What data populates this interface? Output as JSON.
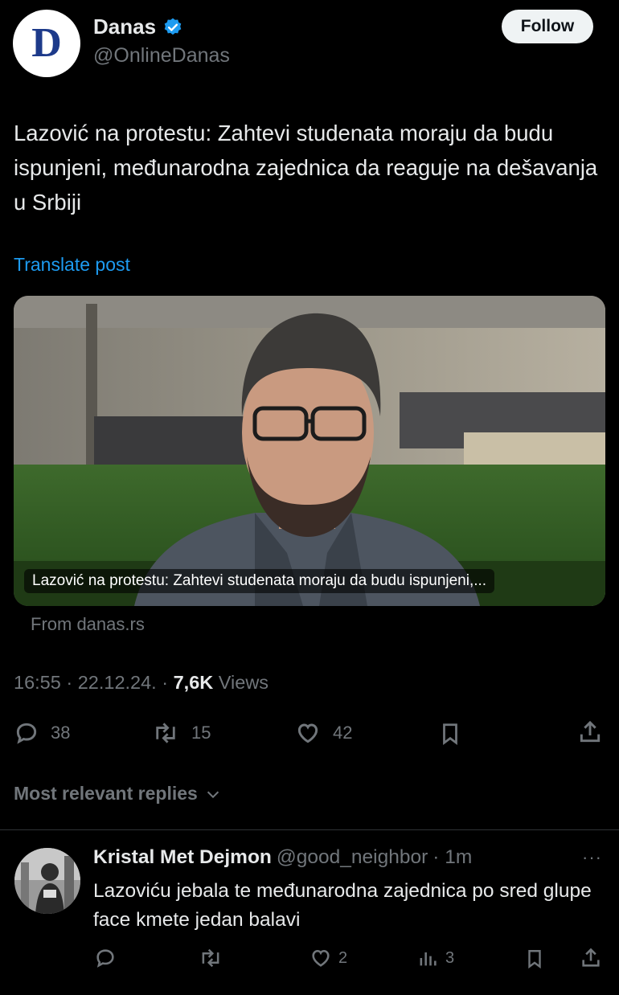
{
  "post": {
    "author_name": "Danas",
    "author_handle": "@OnlineDanas",
    "avatar_letter": "D",
    "follow_label": "Follow",
    "text": "Lazović na protestu: Zahtevi studenata moraju da budu ispunjeni, međunarodna zajednica da reaguje na dešavanja u Srbiji",
    "translate_label": "Translate post",
    "card_caption": "Lazović na protestu: Zahtevi studenata moraju da budu ispunjeni,...",
    "card_source": "From danas.rs",
    "time": "16:55",
    "date": "22.12.24.",
    "views_count": "7,6K",
    "views_label": "Views",
    "replies": "38",
    "reposts": "15",
    "likes": "42"
  },
  "replies_section": {
    "sort_label": "Most relevant replies"
  },
  "reply": {
    "name": "Kristal Met Dejmon",
    "handle": "@good_neighbor",
    "time": "· 1m",
    "more": "···",
    "text": "Lazoviću jebala te međunarodna zajednica po sred glupe face kmete jedan balavi",
    "likes": "2",
    "views": "3"
  },
  "colors": {
    "background": "#000000",
    "text": "#e7e9ea",
    "secondary": "#71767b",
    "link": "#1d9bf0",
    "verified": "#1d9bf0"
  }
}
